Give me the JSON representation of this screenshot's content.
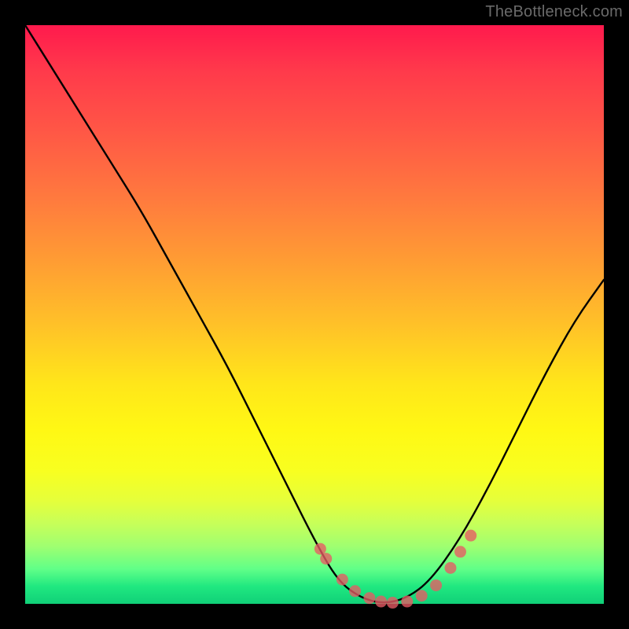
{
  "watermark": "TheBottleneck.com",
  "chart_data": {
    "type": "line",
    "title": "",
    "xlabel": "",
    "ylabel": "",
    "xlim": [
      0,
      1
    ],
    "ylim": [
      0,
      1
    ],
    "background_gradient": {
      "top_color": "#ff1a4d",
      "mid_color": "#ffe61a",
      "bottom_color": "#10d078"
    },
    "series": [
      {
        "name": "bottleneck-curve",
        "x": [
          0.0,
          0.05,
          0.1,
          0.15,
          0.2,
          0.25,
          0.3,
          0.35,
          0.4,
          0.45,
          0.5,
          0.54,
          0.58,
          0.62,
          0.66,
          0.7,
          0.75,
          0.8,
          0.85,
          0.9,
          0.95,
          1.0
        ],
        "values": [
          1.0,
          0.92,
          0.84,
          0.76,
          0.68,
          0.59,
          0.5,
          0.41,
          0.31,
          0.21,
          0.11,
          0.04,
          0.01,
          0.0,
          0.01,
          0.04,
          0.11,
          0.2,
          0.3,
          0.4,
          0.49,
          0.56
        ]
      }
    ],
    "highlight_dots": {
      "name": "optimal-range",
      "x": [
        0.51,
        0.52,
        0.548,
        0.57,
        0.595,
        0.615,
        0.635,
        0.66,
        0.685,
        0.71,
        0.735,
        0.752,
        0.77
      ],
      "values": [
        0.095,
        0.078,
        0.042,
        0.022,
        0.01,
        0.004,
        0.002,
        0.004,
        0.014,
        0.032,
        0.062,
        0.09,
        0.118
      ]
    }
  }
}
